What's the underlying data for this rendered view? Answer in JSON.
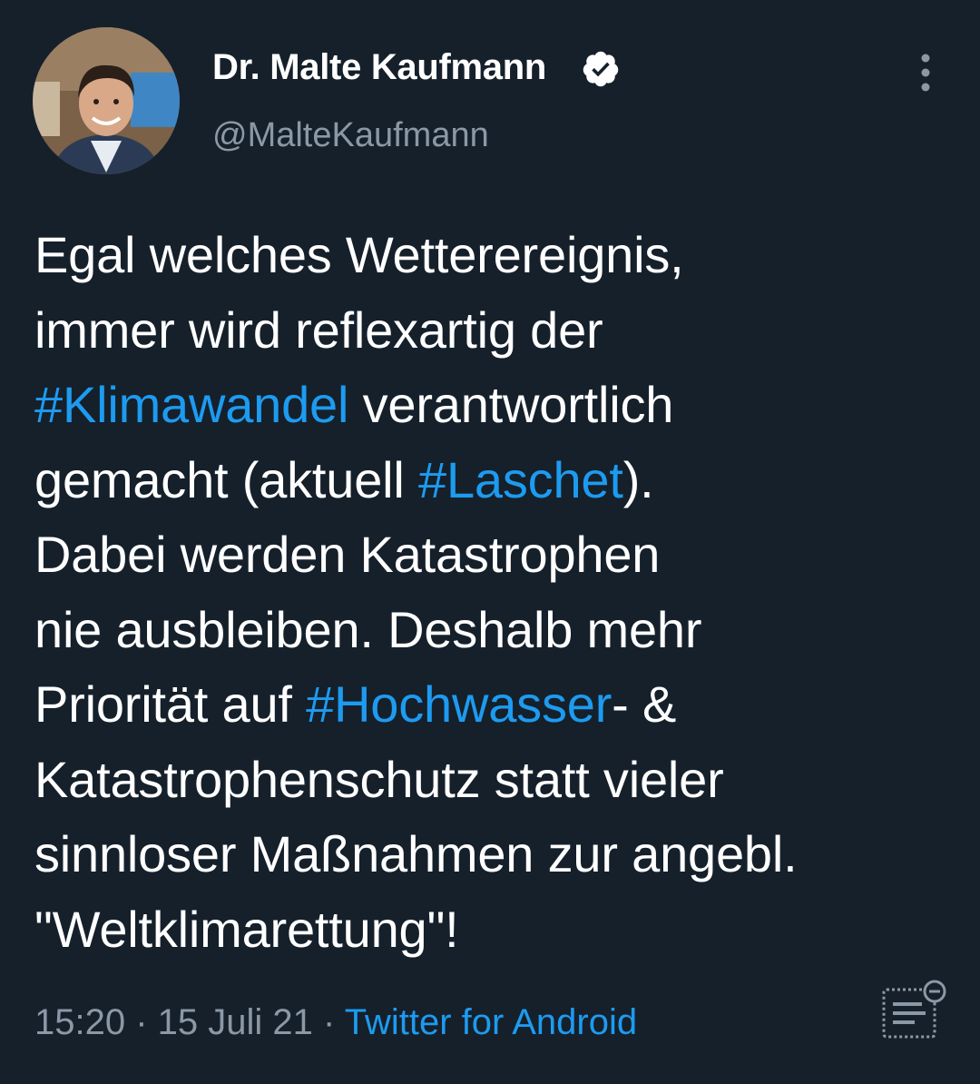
{
  "author": {
    "name": "Dr. Malte Kaufmann",
    "handle": "@MalteKaufmann",
    "verified_icon": "verified-badge-icon"
  },
  "tweet": {
    "lines": [
      [
        {
          "text": "Egal welches Wetterereignis,"
        }
      ],
      [
        {
          "text": "immer wird reflexartig der"
        }
      ],
      [
        {
          "text": "#Klimawandel",
          "hashtag": true
        },
        {
          "text": " verantwortlich"
        }
      ],
      [
        {
          "text": "gemacht (aktuell "
        },
        {
          "text": "#Laschet",
          "hashtag": true
        },
        {
          "text": ")."
        }
      ],
      [
        {
          "text": "Dabei werden Katastrophen"
        }
      ],
      [
        {
          "text": "nie ausbleiben. Deshalb mehr"
        }
      ],
      [
        {
          "text": "Priorität auf "
        },
        {
          "text": "#Hochwasser",
          "hashtag": true
        },
        {
          "text": "- &"
        }
      ],
      [
        {
          "text": "Katastrophenschutz statt vieler"
        }
      ],
      [
        {
          "text": "sinnloser Maßnahmen zur angebl."
        }
      ],
      [
        {
          "text": "\"Weltklimarettung\"!"
        }
      ]
    ]
  },
  "meta": {
    "time": "15:20",
    "separator": " · ",
    "date": "15 Juli 21",
    "source": "Twitter for Android"
  },
  "colors": {
    "background": "#15202b",
    "text": "#ffffff",
    "secondary": "#8b98a5",
    "accent": "#1d9bf0"
  }
}
